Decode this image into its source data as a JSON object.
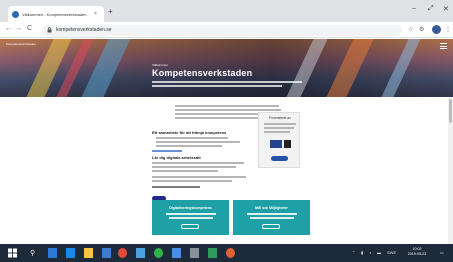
{
  "browser": {
    "tab_title": "Välkommen - Kompetensverkstaden",
    "tab_close": "×",
    "new_tab": "+",
    "url": "kompetensverkstaden.se",
    "window_controls": {
      "minimize": "–",
      "restore": "⤢",
      "close": "✕"
    },
    "nav": {
      "back": "←",
      "forward": "→",
      "reload": "C"
    },
    "icons": [
      "lock-icon",
      "star-icon",
      "extension-icon",
      "profile-avatar",
      "menu-icon"
    ]
  },
  "hero": {
    "small_brand": "Kompetensverkstaden",
    "kicker": "Välkommen",
    "title": "Kompetensverkstaden"
  },
  "content": {
    "section1_heading": "Ett samarbete för att främja kompetens",
    "section2_heading": "Lär dig digitala arbetssätt",
    "card_title": "Finansierat av",
    "panel_left_title": "Digitaliseringskompetens",
    "panel_right_title": "Mål och Möjligheter"
  },
  "taskbar": {
    "search_symbol": "⚲",
    "tray_text": "SWE",
    "time": "10:02",
    "date": "2019-05-23"
  },
  "colors": {
    "accent_blue": "#1f2a8a",
    "teal": "#1fa0a6",
    "taskbar": "#1d2a3a"
  }
}
